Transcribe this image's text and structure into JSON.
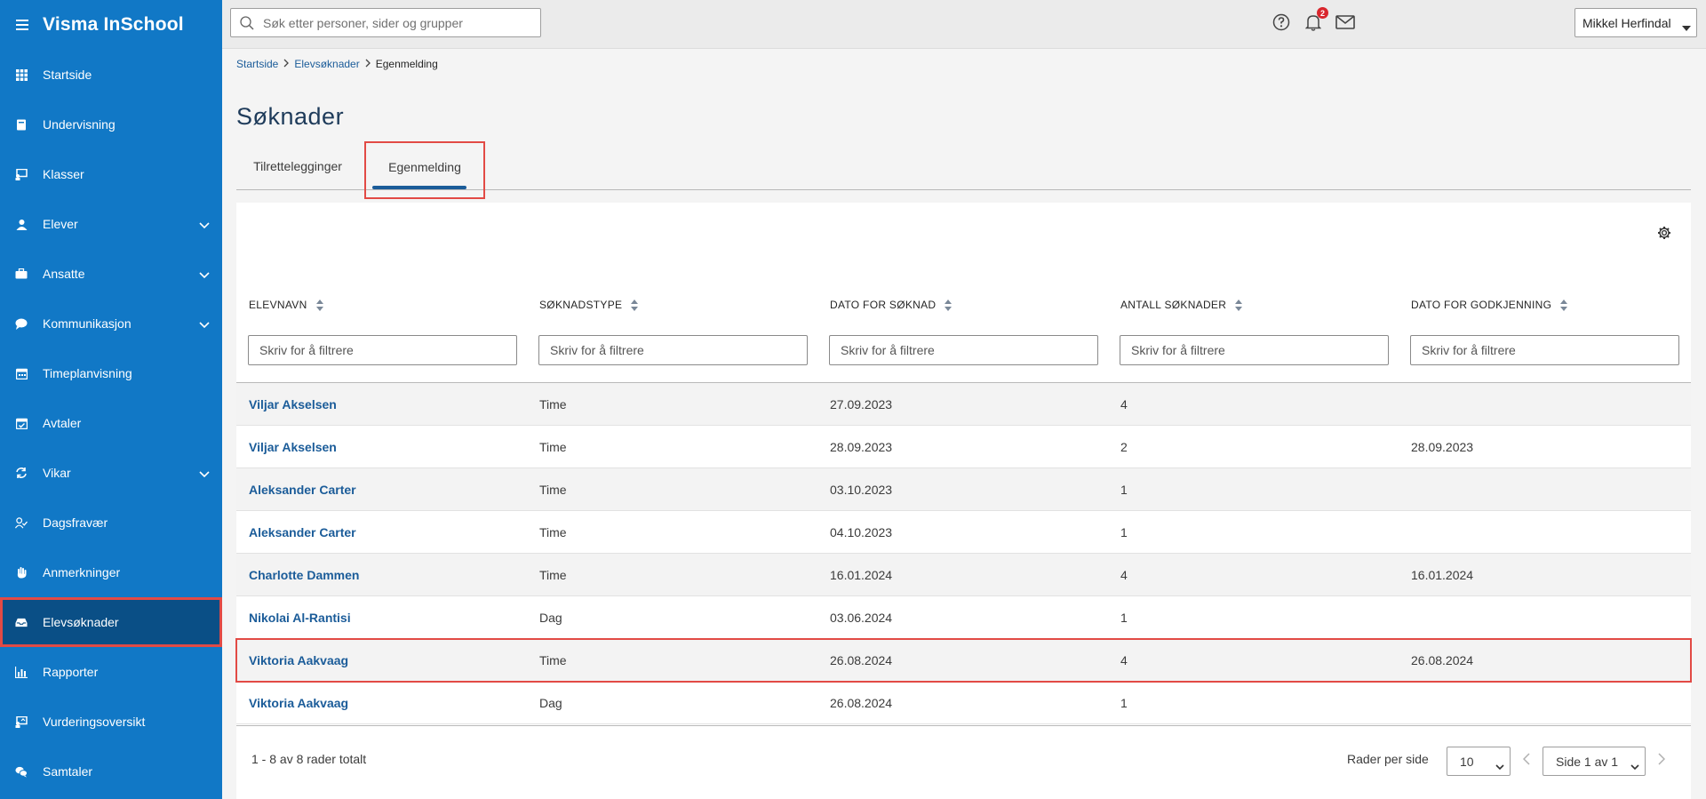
{
  "app": {
    "brand": "Visma InSchool",
    "menu_icon": "hamburger-icon"
  },
  "sidebar": {
    "items": [
      {
        "label": "Startside",
        "icon": "grid-icon",
        "expandable": false
      },
      {
        "label": "Undervisning",
        "icon": "book-icon",
        "expandable": false
      },
      {
        "label": "Klasser",
        "icon": "presentation-icon",
        "expandable": false
      },
      {
        "label": "Elever",
        "icon": "student-icon",
        "expandable": true
      },
      {
        "label": "Ansatte",
        "icon": "briefcase-icon",
        "expandable": true
      },
      {
        "label": "Kommunikasjon",
        "icon": "chat-icon",
        "expandable": true
      },
      {
        "label": "Timeplanvisning",
        "icon": "calendar-icon",
        "expandable": false
      },
      {
        "label": "Avtaler",
        "icon": "calendar-check-icon",
        "expandable": false
      },
      {
        "label": "Vikar",
        "icon": "refresh-icon",
        "expandable": true
      },
      {
        "label": "Dagsfravær",
        "icon": "user-check-icon",
        "expandable": false
      },
      {
        "label": "Anmerkninger",
        "icon": "hand-icon",
        "expandable": false
      },
      {
        "label": "Elevsøknader",
        "icon": "inbox-icon",
        "expandable": false,
        "active": true
      },
      {
        "label": "Rapporter",
        "icon": "bar-chart-icon",
        "expandable": false
      },
      {
        "label": "Vurderingsoversikt",
        "icon": "assessment-icon",
        "expandable": false
      },
      {
        "label": "Samtaler",
        "icon": "conversation-icon",
        "expandable": false
      }
    ]
  },
  "topbar": {
    "search_placeholder": "Søk etter personer, sider og grupper",
    "notification_count": "2",
    "user_name": "Mikkel Herfindal"
  },
  "breadcrumb": {
    "items": [
      "Startside",
      "Elevsøknader"
    ],
    "current": "Egenmelding"
  },
  "page": {
    "title": "Søknader",
    "tabs": [
      "Tilrettelegginger",
      "Egenmelding"
    ],
    "active_tab": "Egenmelding"
  },
  "table": {
    "columns": [
      "ELEVNAVN",
      "SØKNADSTYPE",
      "DATO FOR SØKNAD",
      "ANTALL SØKNADER",
      "DATO FOR GODKJENNING"
    ],
    "filter_placeholder": "Skriv for å filtrere",
    "rows": [
      [
        "Viljar Akselsen",
        "Time",
        "27.09.2023",
        "4",
        ""
      ],
      [
        "Viljar Akselsen",
        "Time",
        "28.09.2023",
        "2",
        "28.09.2023"
      ],
      [
        "Aleksander Carter",
        "Time",
        "03.10.2023",
        "1",
        ""
      ],
      [
        "Aleksander Carter",
        "Time",
        "04.10.2023",
        "1",
        ""
      ],
      [
        "Charlotte Dammen",
        "Time",
        "16.01.2024",
        "4",
        "16.01.2024"
      ],
      [
        "Nikolai Al-Rantisi",
        "Dag",
        "03.06.2024",
        "1",
        ""
      ],
      [
        "Viktoria Aakvaag",
        "Time",
        "26.08.2024",
        "4",
        "26.08.2024"
      ],
      [
        "Viktoria Aakvaag",
        "Dag",
        "26.08.2024",
        "1",
        ""
      ]
    ],
    "highlighted_row": 6
  },
  "footer": {
    "count_text": "1 - 8 av 8 rader totalt",
    "rows_per_page_label": "Rader per side",
    "rows_per_page": "10",
    "page_text": "Side 1 av 1"
  },
  "colors": {
    "sidebar": "#1178c6",
    "sidebar_active": "#0a4f86",
    "link": "#1b5c99",
    "highlight": "#e24a45"
  }
}
